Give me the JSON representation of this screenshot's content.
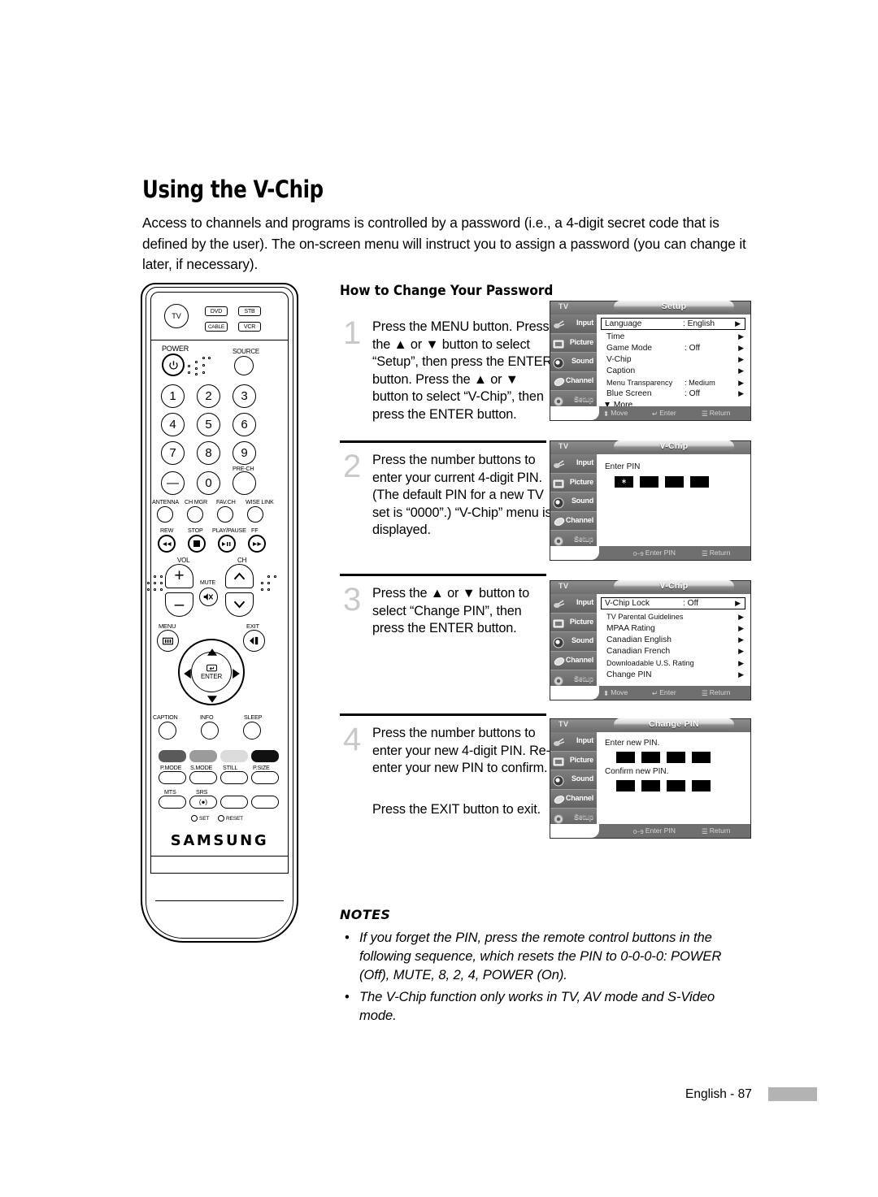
{
  "page": {
    "title": "Using the V-Chip",
    "intro": "Access to channels and programs is controlled by a password (i.e., a 4-digit secret code that is defined by the user). The on-screen menu will instruct you to assign a password (you can change it later, if necessary).",
    "section_heading": "How to Change Your Password",
    "footer_text": "English - 87"
  },
  "steps": [
    {
      "num": "1",
      "lines": "Press the MENU button. Press the ▲ or ▼ button to select “Setup”, then press the ENTER button. Press the ▲ or ▼ button to select “V-Chip”, then press the ENTER button."
    },
    {
      "num": "2",
      "lines": "Press the number buttons to enter your current 4-digit PIN. (The default PIN for a new TV set is “0000”.) “V-Chip” menu is displayed."
    },
    {
      "num": "3",
      "lines": "Press the ▲ or ▼ button to select “Change PIN”, then press the ENTER button."
    },
    {
      "num": "4",
      "lines": "Press the number buttons to enter your new 4-digit PIN. Re-enter your new PIN to confirm.",
      "extra": "Press the EXIT button to exit."
    }
  ],
  "notes": {
    "heading": "NOTES",
    "items": [
      "If you forget the PIN, press the remote control buttons in the following sequence, which resets the PIN to 0-0-0-0: POWER (Off), MUTE, 8, 2, 4, POWER (On).",
      "The V-Chip function only works in TV, AV mode and S-Video mode."
    ]
  },
  "remote": {
    "brand": "SAMSUNG",
    "mode_buttons": [
      "TV",
      "DVD",
      "STB",
      "CABLE",
      "VCR"
    ],
    "power_label": "POWER",
    "source_label": "SOURCE",
    "numbers": [
      "1",
      "2",
      "3",
      "4",
      "5",
      "6",
      "7",
      "8",
      "9",
      "—",
      "0"
    ],
    "prech_label": "PRE-CH",
    "row_labels_1": [
      "ANTENNA",
      "CH MGR",
      "FAV.CH",
      "WISE LINK"
    ],
    "transport_labels": [
      "REW",
      "STOP",
      "PLAY/PAUSE",
      "FF"
    ],
    "vol_label": "VOL",
    "ch_label": "CH",
    "mute_label": "MUTE",
    "menu_label": "MENU",
    "exit_label": "EXIT",
    "enter_label": "ENTER",
    "row_labels_2": [
      "CAPTION",
      "INFO",
      "SLEEP"
    ],
    "row_labels_3": [
      "P.MODE",
      "S.MODE",
      "STILL",
      "P.SIZE"
    ],
    "row_labels_4": [
      "MTS",
      "SRS"
    ],
    "set_label": "SET",
    "reset_label": "RESET",
    "color_keys": [
      "#5a5a5a",
      "#9b9b9b",
      "#dcdcdc",
      "#111111"
    ]
  },
  "tv_menus": [
    {
      "id": "setup",
      "tv_label": "TV",
      "title": "Setup",
      "sidebar": [
        "Input",
        "Picture",
        "Sound",
        "Channel",
        "Setup"
      ],
      "sidebar_selected": "Setup",
      "rows": [
        {
          "label": "Language",
          "value": ": English",
          "arrow": "▶",
          "highlight": true
        },
        {
          "label": "Time",
          "value": "",
          "arrow": "▶",
          "highlight": false
        },
        {
          "label": "Game Mode",
          "value": ": Off",
          "arrow": "▶",
          "highlight": false
        },
        {
          "label": "V-Chip",
          "value": "",
          "arrow": "▶",
          "highlight": false
        },
        {
          "label": "Caption",
          "value": "",
          "arrow": "▶",
          "highlight": false
        },
        {
          "label": "Menu Transparency",
          "value": ": Medium",
          "arrow": "▶",
          "highlight": false,
          "small": true
        },
        {
          "label": "Blue Screen",
          "value": ": Off",
          "arrow": "▶",
          "highlight": false
        }
      ],
      "more": "▼ More",
      "footer": [
        {
          "icon": "⬍",
          "text": "Move"
        },
        {
          "icon": "↵",
          "text": "Enter"
        },
        {
          "icon": "☰",
          "text": "Return"
        }
      ]
    },
    {
      "id": "vchip-pin",
      "tv_label": "TV",
      "title": "V-Chip",
      "sidebar": [
        "Input",
        "Picture",
        "Sound",
        "Channel",
        "Setup"
      ],
      "sidebar_selected": "Setup",
      "pin_prompt": "Enter PIN",
      "pin_boxes": [
        "∗",
        "",
        "",
        ""
      ],
      "footer": [
        {
          "icon": "0~9",
          "text": "Enter PIN"
        },
        {
          "icon": "☰",
          "text": "Return"
        }
      ]
    },
    {
      "id": "vchip",
      "tv_label": "TV",
      "title": "V-Chip",
      "sidebar": [
        "Input",
        "Picture",
        "Sound",
        "Channel",
        "Setup"
      ],
      "sidebar_selected": "Setup",
      "rows": [
        {
          "label": "V-Chip Lock",
          "value": ": Off",
          "arrow": "▶",
          "highlight": true
        },
        {
          "label": "TV Parental Guidelines",
          "value": "",
          "arrow": "▶",
          "highlight": false,
          "small": true
        },
        {
          "label": "MPAA Rating",
          "value": "",
          "arrow": "▶",
          "highlight": false
        },
        {
          "label": "Canadian English",
          "value": "",
          "arrow": "▶",
          "highlight": false
        },
        {
          "label": "Canadian French",
          "value": "",
          "arrow": "▶",
          "highlight": false
        },
        {
          "label": "Downloadable U.S. Rating",
          "value": "",
          "arrow": "▶",
          "highlight": false,
          "small": true
        },
        {
          "label": "Change PIN",
          "value": "",
          "arrow": "▶",
          "highlight": false
        }
      ],
      "footer": [
        {
          "icon": "⬍",
          "text": "Move"
        },
        {
          "icon": "↵",
          "text": "Enter"
        },
        {
          "icon": "☰",
          "text": "Return"
        }
      ]
    },
    {
      "id": "change-pin",
      "tv_label": "TV",
      "title": "Change PIN",
      "sidebar": [
        "Input",
        "Picture",
        "Sound",
        "Channel",
        "Setup"
      ],
      "sidebar_selected": "Setup",
      "pin_prompt": "Enter new PIN.",
      "pin_prompt2": "Confirm new PIN.",
      "pin_boxes": [
        "",
        "",
        "",
        ""
      ],
      "pin_boxes2": [
        "",
        "",
        "",
        ""
      ],
      "footer": [
        {
          "icon": "0~9",
          "text": "Enter PIN"
        },
        {
          "icon": "☰",
          "text": "Return"
        }
      ]
    }
  ]
}
